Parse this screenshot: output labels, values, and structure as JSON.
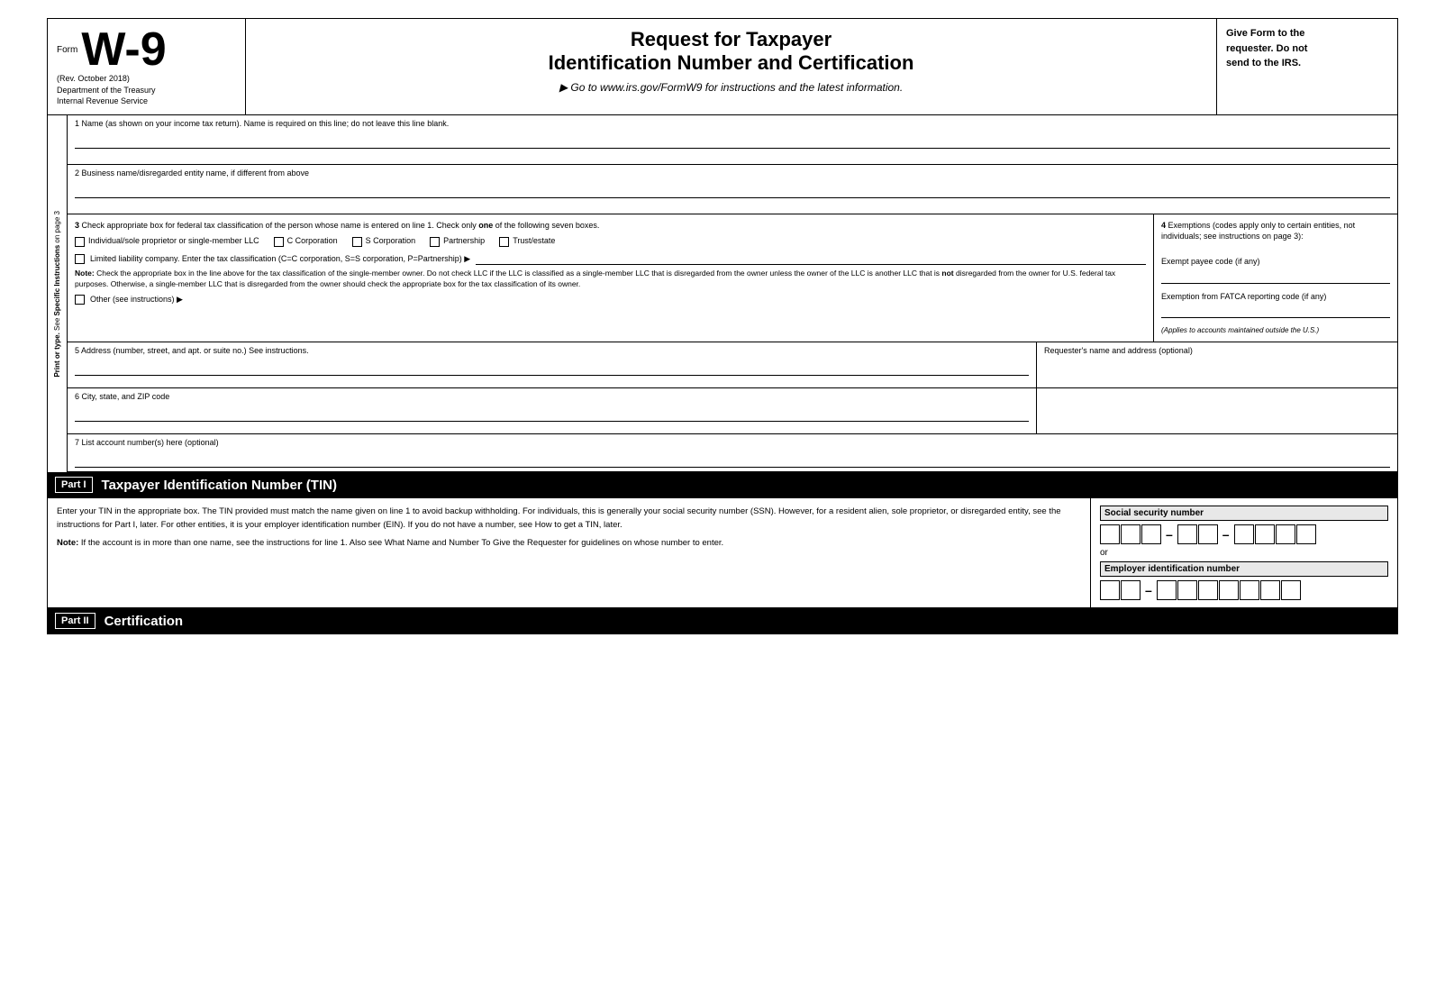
{
  "header": {
    "form_label": "Form",
    "form_number": "W-9",
    "rev_date": "(Rev. October 2018)",
    "department": "Department of the Treasury",
    "irs": "Internal Revenue Service",
    "title_line1": "Request for Taxpayer",
    "title_line2": "Identification Number and Certification",
    "subtitle": "▶ Go to www.irs.gov/FormW9 for instructions and the latest information.",
    "right_text_line1": "Give Form to the",
    "right_text_line2": "requester. Do not",
    "right_text_line3": "send to the IRS."
  },
  "sidebar": {
    "text": "Print or type. See Specific Instructions on page 3"
  },
  "fields": {
    "field1_label": "1  Name (as shown on your income tax return). Name is required on this line; do not leave this line blank.",
    "field2_label": "2  Business name/disregarded entity name, if different from above",
    "field3_label": "3  Check appropriate box for federal tax classification of the person whose name is entered on line 1. Check only one of the following seven boxes.",
    "checkbox_individual": "Individual/sole proprietor or single-member LLC",
    "checkbox_c_corp": "C Corporation",
    "checkbox_s_corp": "S Corporation",
    "checkbox_partnership": "Partnership",
    "checkbox_trust": "Trust/estate",
    "llc_label": "Limited liability company. Enter the tax classification (C=C corporation, S=S corporation, P=Partnership) ▶",
    "note_text": "Note: Check the appropriate box in the line above for the tax classification of the single-member owner. Do not check LLC if the LLC is classified as a single-member LLC that is disregarded from the owner unless the owner of the LLC is another LLC that is not disregarded from the owner for U.S. federal tax purposes. Otherwise, a single-member LLC that is disregarded from the owner should check the appropriate box for the tax classification of its owner.",
    "note_bold": "Note:",
    "not_bold": " not",
    "other_label": "Other (see instructions) ▶",
    "exemptions_header": "4  Exemptions (codes apply only to certain entities, not individuals; see instructions on page 3):",
    "exempt_payee_label": "Exempt payee code (if any)",
    "fatca_label": "Exemption from FATCA reporting code (if any)",
    "applies_note": "(Applies to accounts maintained outside the U.S.)",
    "field5_label": "5  Address (number, street, and apt. or suite no.) See instructions.",
    "requester_label": "Requester's name and address (optional)",
    "field6_label": "6  City, state, and ZIP code",
    "field7_label": "7  List account number(s) here (optional)"
  },
  "part_i": {
    "badge": "Part I",
    "title": "Taxpayer Identification Number (TIN)",
    "body_text": "Enter your TIN in the appropriate box. The TIN provided must match the name given on line 1 to avoid backup withholding. For individuals, this is generally your social security number (SSN). However, for a resident alien, sole proprietor, or disregarded entity, see the instructions for Part I, later. For other entities, it is your employer identification number (EIN). If you do not have a number, see How to get a TIN, later.",
    "note_label": "Note:",
    "note_text": " If the account is in more than one name, see the instructions for line 1. Also see What Name and Number To Give the Requester for guidelines on whose number to enter.",
    "ssn_label": "Social security number",
    "or_text": "or",
    "ein_label": "Employer identification number",
    "ssn_group1_count": 3,
    "ssn_group2_count": 2,
    "ssn_group3_count": 4,
    "ein_group1_count": 2,
    "ein_group2_count": 7
  },
  "part_ii": {
    "badge": "Part II",
    "title": "Certification"
  }
}
